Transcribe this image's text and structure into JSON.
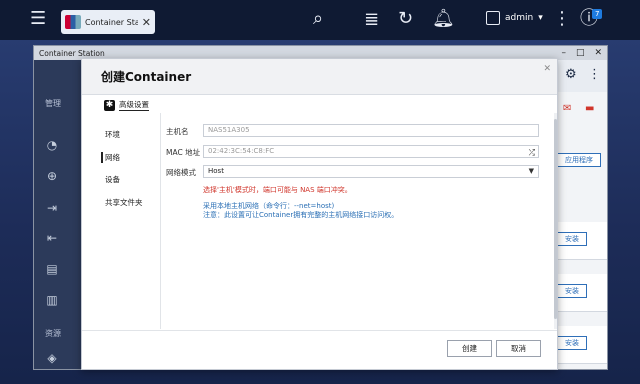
{
  "topbar": {
    "tab_label": "Container Sta...",
    "user_name": "admin",
    "badge_count": "7"
  },
  "bg_window": {
    "title": "Container Station",
    "app_title_trunc": "Co",
    "sidebar": {
      "section_manage": "管理",
      "section_resource": "资源",
      "items": [
        "总",
        "创",
        "导",
        "导",
        "记",
        "属",
        "镜"
      ]
    },
    "apps_button": "应用程序",
    "install_label": "安装"
  },
  "modal": {
    "title": "创建Container",
    "advanced": "高级设置",
    "nav": [
      "环境",
      "网络",
      "设备",
      "共享文件夹"
    ],
    "active_nav": "网络",
    "fields": {
      "hostname_label": "主机名",
      "hostname_placeholder": "NAS51A305",
      "mac_label": "MAC 地址",
      "mac_placeholder": "02:42:3C:54:C8:FC",
      "mode_label": "网络模式",
      "mode_value": "Host"
    },
    "warning": "选择'主机'模式时，端口可能与 NAS 端口冲突。",
    "info_line1": "采用本地主机网络（命令行：--net=host)",
    "info_line2": "注意：此设置可让Container拥有完整的主机网络接口访问权。",
    "buttons": {
      "create": "创建",
      "cancel": "取消"
    }
  }
}
